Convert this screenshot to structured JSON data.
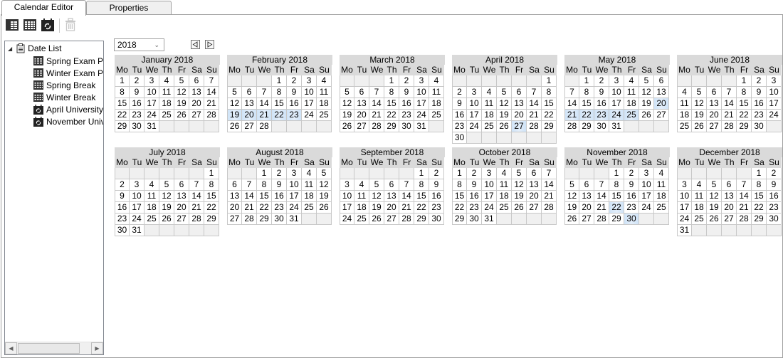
{
  "tabs": [
    {
      "label": "Calendar Editor",
      "active": true
    },
    {
      "label": "Properties",
      "active": false
    }
  ],
  "toolbar": {
    "buttons": [
      {
        "icon": "calendar-dark-grid-icon",
        "enabled": true
      },
      {
        "icon": "calendar-grid-icon",
        "enabled": true
      },
      {
        "icon": "calendar-recurring-icon",
        "enabled": true
      },
      {
        "icon": "delete-icon",
        "enabled": false
      }
    ]
  },
  "tree": {
    "root_label": "Date List",
    "items": [
      {
        "label": "Spring Exam Pr",
        "icon": "calendar-dark-grid-icon"
      },
      {
        "label": "Winter Exam Pr",
        "icon": "calendar-dark-grid-icon"
      },
      {
        "label": "Spring Break",
        "icon": "calendar-grid-icon"
      },
      {
        "label": "Winter Break",
        "icon": "calendar-grid-icon"
      },
      {
        "label": "April University",
        "icon": "calendar-recurring-icon"
      },
      {
        "label": "November Univ",
        "icon": "calendar-recurring-icon"
      }
    ]
  },
  "year_select": {
    "value": "2018"
  },
  "weekday_labels": [
    "Mo",
    "Tu",
    "We",
    "Th",
    "Fr",
    "Sa",
    "Su"
  ],
  "highlight_color": "#cfe3f7",
  "months": [
    {
      "title": "January 2018",
      "offset": 0,
      "days": 31,
      "highlighted": []
    },
    {
      "title": "February 2018",
      "offset": 3,
      "days": 28,
      "highlighted": [
        19,
        20,
        21,
        22,
        23
      ]
    },
    {
      "title": "March 2018",
      "offset": 3,
      "days": 31,
      "highlighted": []
    },
    {
      "title": "April 2018",
      "offset": 6,
      "days": 30,
      "highlighted": [
        27
      ]
    },
    {
      "title": "May 2018",
      "offset": 1,
      "days": 31,
      "highlighted": [
        20,
        21,
        22,
        23,
        24,
        25
      ]
    },
    {
      "title": "June 2018",
      "offset": 4,
      "days": 30,
      "highlighted": []
    },
    {
      "title": "July 2018",
      "offset": 6,
      "days": 31,
      "highlighted": []
    },
    {
      "title": "August 2018",
      "offset": 2,
      "days": 31,
      "highlighted": []
    },
    {
      "title": "September 2018",
      "offset": 5,
      "days": 30,
      "highlighted": []
    },
    {
      "title": "October 2018",
      "offset": 0,
      "days": 31,
      "highlighted": []
    },
    {
      "title": "November 2018",
      "offset": 3,
      "days": 30,
      "highlighted": [
        22,
        30
      ]
    },
    {
      "title": "December 2018",
      "offset": 5,
      "days": 31,
      "highlighted": []
    }
  ]
}
